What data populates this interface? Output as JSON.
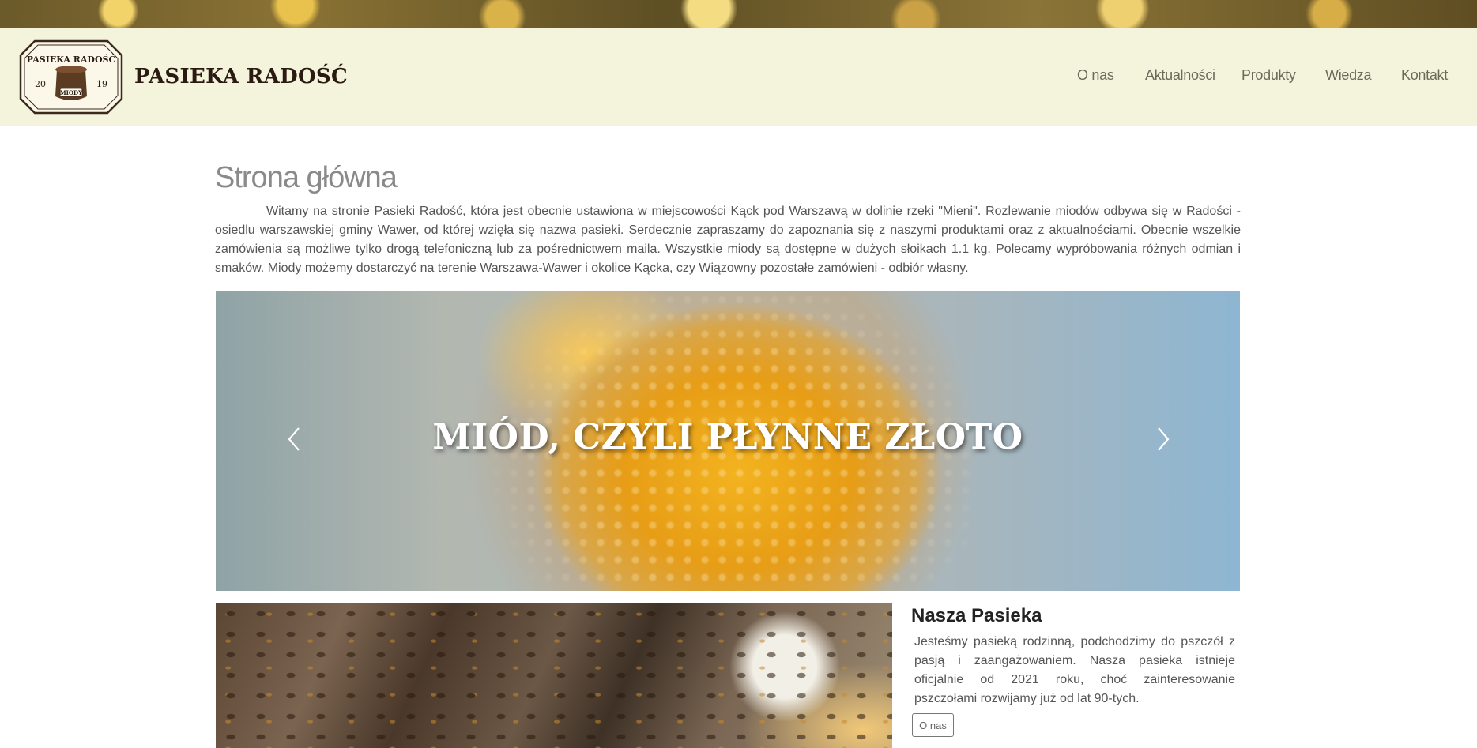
{
  "header": {
    "logo": {
      "top_text": "PASIEKA RADOŚĆ",
      "year_left": "20",
      "year_right": "19",
      "jar_label": "MIODY"
    },
    "brand_name": "PASIEKA RADOŚĆ",
    "nav": [
      {
        "label": "O nas"
      },
      {
        "label": "Aktualności"
      },
      {
        "label": "Produkty"
      },
      {
        "label": "Wiedza"
      },
      {
        "label": "Kontakt"
      }
    ]
  },
  "main": {
    "page_title": "Strona główna",
    "intro": "Witamy na stronie Pasieki Radość, która jest obecnie ustawiona w miejscowości Kąck pod Warszawą w dolinie rzeki \"Mieni\". Rozlewanie miodów odbywa się w Radości - osiedlu warszawskiej gminy Wawer, od której wzięła się nazwa pasieki. Serdecznie zapraszamy do zapoznania się z naszymi produktami oraz z aktualnościami. Obecnie wszelkie zamówienia są możliwe tylko drogą telefoniczną lub za pośrednictwem maila. Wszystkie miody są dostępne w dużych słoikach 1.1 kg. Polecamy wypróbowania różnych odmian i smaków. Miody możemy dostarczyć na terenie Warszawa-Wawer i okolice Kącka, czy Wiązowny pozostałe zamówieni - odbiór własny.",
    "carousel": {
      "caption": "MIÓD, CZYLI PŁYNNE ZŁOTO",
      "prev_icon": "chevron-left-icon",
      "next_icon": "chevron-right-icon"
    },
    "about": {
      "title": "Nasza Pasieka",
      "text": "Jesteśmy pasieką rodzinną, podchodzimy do pszczół z pasją i zaangażowaniem. Nasza pasieka istnieje oficjalnie od 2021 roku, choć zainteresowanie pszczołami rozwijamy już od lat 90-tych.",
      "button_label": "O nas"
    }
  },
  "colors": {
    "header_bg": "#f4f3dc",
    "brand_text": "#2a1a12",
    "nav_text": "#6e6a5a",
    "title_text": "#8a8a8a"
  }
}
